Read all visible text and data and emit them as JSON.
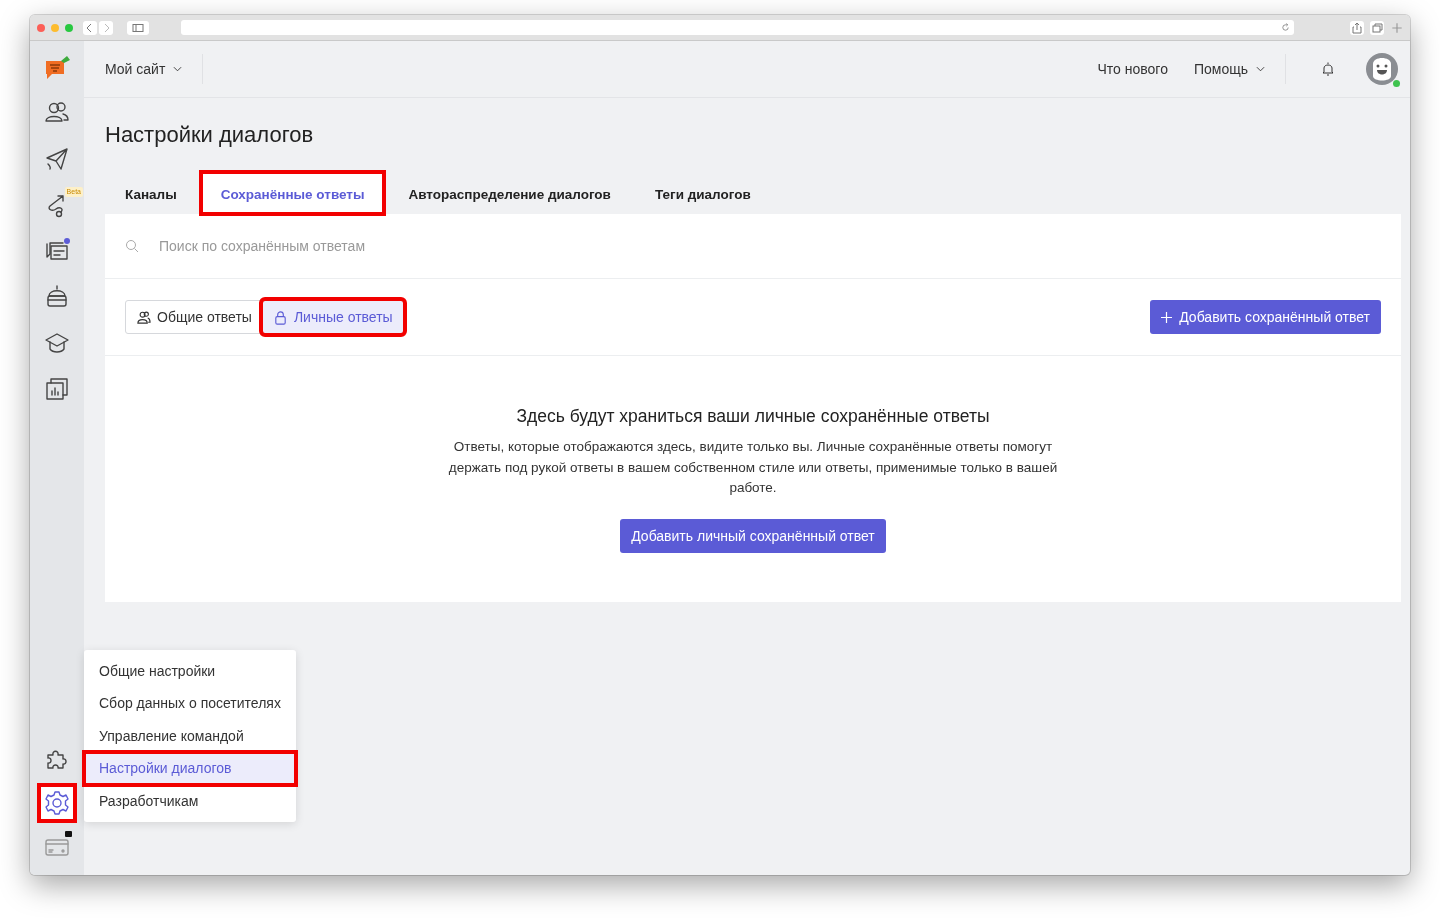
{
  "sidebar": {
    "top": [
      {
        "selected": false
      },
      {
        "selected": false
      },
      {
        "selected": false,
        "badge": "Beta"
      },
      {
        "selected": false,
        "notification": true
      },
      {
        "selected": false
      },
      {
        "selected": false
      },
      {
        "selected": false
      }
    ],
    "bottom": [
      {
        "selected": false,
        "highlighted": false
      },
      {
        "selected": true,
        "highlighted": true
      },
      {
        "selected": false,
        "highlighted": false,
        "locked": true
      }
    ]
  },
  "topbar": {
    "site": "Мой сайт",
    "links": [
      {
        "label": "Что нового",
        "dropdown": false
      },
      {
        "label": "Помощь",
        "dropdown": true
      }
    ],
    "online": true
  },
  "page": {
    "title": "Настройки диалогов"
  },
  "tabs": [
    {
      "label": "Каналы",
      "selected": false,
      "highlighted": false
    },
    {
      "label": "Сохранённые ответы",
      "selected": true,
      "highlighted": true
    },
    {
      "label": "Автораспределение диалогов",
      "selected": false,
      "highlighted": false
    },
    {
      "label": "Теги диалогов",
      "selected": false,
      "highlighted": false
    }
  ],
  "search": {
    "placeholder": "Поиск по сохранённым ответам"
  },
  "segments": [
    {
      "label": "Общие ответы",
      "selected": false,
      "highlighted": false
    },
    {
      "label": "Личные ответы",
      "selected": true,
      "highlighted": true
    }
  ],
  "add_button": "Добавить сохранённый ответ",
  "empty_state": {
    "title": "Здесь будут храниться ваши личные сохранённые ответы",
    "text": "Ответы, которые отображаются здесь, видите только вы. Личные сохранённые ответы помогут держать под рукой ответы в вашем собственном стиле или ответы, применимые только в вашей работе.",
    "button": "Добавить личный сохранённый ответ"
  },
  "settings_menu": [
    {
      "label": "Общие настройки",
      "selected": false,
      "highlighted": false
    },
    {
      "label": "Сбор данных о посетителях",
      "selected": false,
      "highlighted": false
    },
    {
      "label": "Управление командой",
      "selected": false,
      "highlighted": false
    },
    {
      "label": "Настройки диалогов",
      "selected": true,
      "highlighted": true
    },
    {
      "label": "Разработчикам",
      "selected": false,
      "highlighted": false
    }
  ]
}
